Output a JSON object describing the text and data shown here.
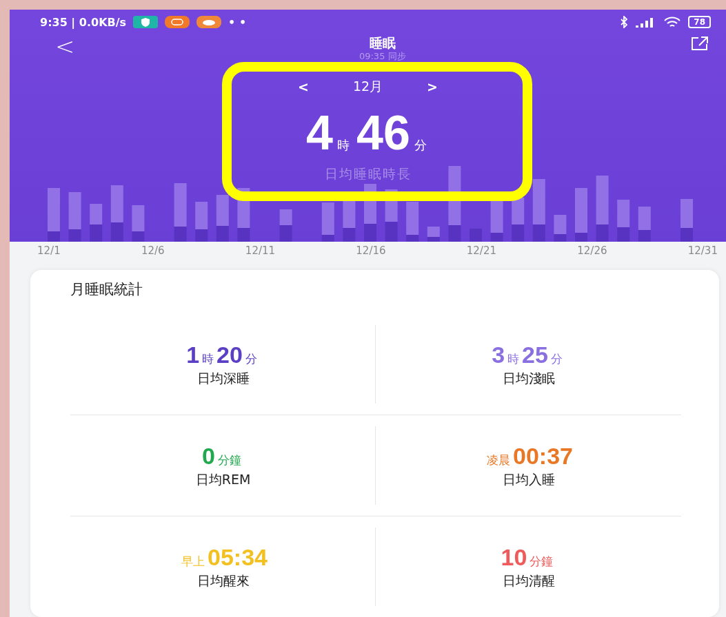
{
  "status_bar": {
    "time": "9:35 | 0.0KB/s",
    "dots": "• •",
    "battery": "78"
  },
  "header": {
    "back": "<",
    "title": "睡眠",
    "subtitle": "09:35 同步"
  },
  "summary": {
    "prev": "<",
    "month": "12月",
    "next": ">",
    "hours": "4",
    "hours_unit": "時",
    "minutes": "46",
    "minutes_unit": "分",
    "caption": "日均睡眠時長",
    "highlighted": true
  },
  "chart": {
    "date_labels": [
      "12/1",
      "12/6",
      "12/11",
      "12/16",
      "12/21",
      "12/26",
      "12/31"
    ]
  },
  "stats_card": {
    "title": "月睡眠統計",
    "items": [
      {
        "color": "#5b3fc4",
        "parts": [
          {
            "text": "1",
            "kind": "big"
          },
          {
            "text": "時",
            "kind": "small"
          },
          {
            "text": "20",
            "kind": "big"
          },
          {
            "text": "分",
            "kind": "small"
          }
        ],
        "label": "日均深睡"
      },
      {
        "color": "#8a6fe0",
        "parts": [
          {
            "text": "3",
            "kind": "big"
          },
          {
            "text": "時",
            "kind": "small"
          },
          {
            "text": "25",
            "kind": "big"
          },
          {
            "text": "分",
            "kind": "small"
          }
        ],
        "label": "日均淺眠"
      },
      {
        "color": "#22a94f",
        "parts": [
          {
            "text": "0",
            "kind": "big"
          },
          {
            "text": "分鐘",
            "kind": "small"
          }
        ],
        "label": "日均REM"
      },
      {
        "color": "#e87826",
        "parts": [
          {
            "text": "凌晨",
            "kind": "small"
          },
          {
            "text": "00:37",
            "kind": "big"
          }
        ],
        "label": "日均入睡"
      },
      {
        "color": "#f2c020",
        "parts": [
          {
            "text": "早上",
            "kind": "small"
          },
          {
            "text": "05:34",
            "kind": "big"
          }
        ],
        "label": "日均醒來"
      },
      {
        "color": "#ef5a5a",
        "parts": [
          {
            "text": "10",
            "kind": "big"
          },
          {
            "text": "分鐘",
            "kind": "small"
          }
        ],
        "label": "日均清醒"
      }
    ]
  }
}
